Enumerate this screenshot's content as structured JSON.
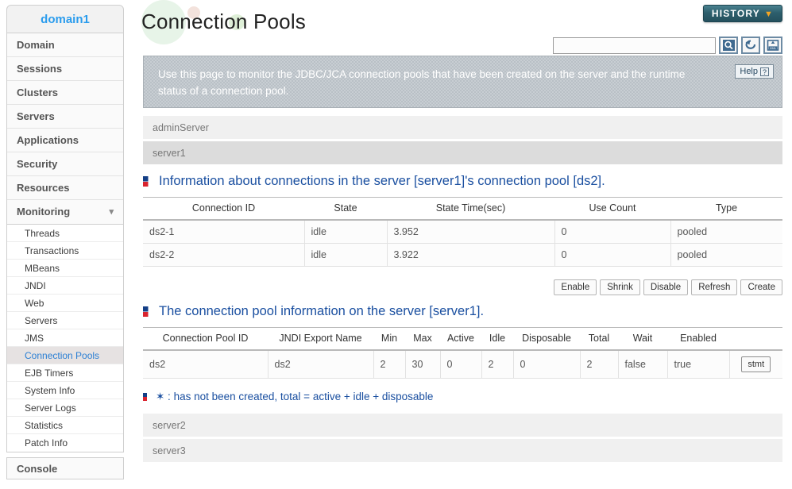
{
  "sidebar": {
    "domain_label": "domain1",
    "top_items": [
      {
        "label": "Domain"
      },
      {
        "label": "Sessions"
      },
      {
        "label": "Clusters"
      },
      {
        "label": "Servers"
      },
      {
        "label": "Applications"
      },
      {
        "label": "Security"
      },
      {
        "label": "Resources"
      },
      {
        "label": "Monitoring",
        "expanded": true,
        "chevron": "chevron-down-icon"
      }
    ],
    "sub_items": [
      {
        "label": "Threads",
        "selected": false
      },
      {
        "label": "Transactions",
        "selected": false
      },
      {
        "label": "MBeans",
        "selected": false
      },
      {
        "label": "JNDI",
        "selected": false
      },
      {
        "label": "Web",
        "selected": false
      },
      {
        "label": "Servers",
        "selected": false
      },
      {
        "label": "JMS",
        "selected": false
      },
      {
        "label": "Connection Pools",
        "selected": true
      },
      {
        "label": "EJB Timers",
        "selected": false
      },
      {
        "label": "System Info",
        "selected": false
      },
      {
        "label": "Server Logs",
        "selected": false
      },
      {
        "label": "Statistics",
        "selected": false
      },
      {
        "label": "Patch Info",
        "selected": false
      }
    ],
    "console_label": "Console"
  },
  "header": {
    "page_title": "Connection Pools",
    "history_label": "HISTORY",
    "history_chevron": "▼",
    "search_value": "",
    "search_placeholder": "",
    "icons": [
      {
        "name": "search-icon",
        "title": "Search"
      },
      {
        "name": "refresh-icon",
        "title": "Refresh"
      },
      {
        "name": "xml-export-icon",
        "title": "XML"
      }
    ]
  },
  "banner": {
    "text": "Use this page to monitor the JDBC/JCA connection pools that have been created on the server and the runtime status of a connection pool.",
    "help_label": "Help",
    "help_mark": "?"
  },
  "server_tabs_top": [
    {
      "label": "adminServer",
      "selected": false
    },
    {
      "label": "server1",
      "selected": true
    }
  ],
  "server_tabs_bottom": [
    {
      "label": "server2",
      "selected": false
    },
    {
      "label": "server3",
      "selected": false
    }
  ],
  "section1": {
    "heading": "Information about connections in the server [server1]'s connection pool [ds2].",
    "columns": [
      "Connection ID",
      "State",
      "State Time(sec)",
      "Use Count",
      "Type"
    ],
    "rows": [
      [
        "ds2-1",
        "idle",
        "3.952",
        "0",
        "pooled"
      ],
      [
        "ds2-2",
        "idle",
        "3.922",
        "0",
        "pooled"
      ]
    ],
    "buttons": [
      "Enable",
      "Shrink",
      "Disable",
      "Refresh",
      "Create"
    ]
  },
  "section2": {
    "heading": "The connection pool information on the server [server1].",
    "columns": [
      "Connection Pool ID",
      "JNDI Export Name",
      "Min",
      "Max",
      "Active",
      "Idle",
      "Disposable",
      "Total",
      "Wait",
      "Enabled",
      ""
    ],
    "rows": [
      [
        "ds2",
        "ds2",
        "2",
        "30",
        "0",
        "2",
        "0",
        "2",
        "false",
        "true",
        "stmt"
      ]
    ],
    "footnote": "✶ : has not been created, total = active + idle + disposable"
  },
  "colors": {
    "accent_blue": "#1a4fa0",
    "domain_blue": "#2a9ced",
    "history_teal": "#2d5f6d",
    "history_chevron_orange": "#f5a623",
    "banner_gray": "#b9c0c6",
    "selected_row": "#dcdcdc"
  }
}
